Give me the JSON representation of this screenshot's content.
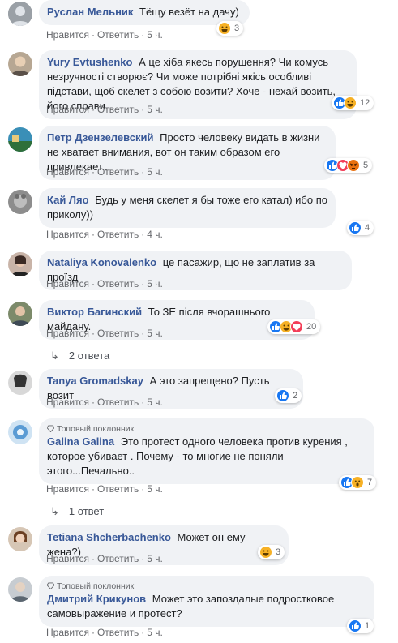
{
  "actions": {
    "like": "Нравится",
    "reply": "Ответить",
    "sep": "·"
  },
  "top_fan_label": "Топовый поклонник",
  "comments": [
    {
      "name": "Руслан Мельник",
      "text": "Тёщу везёт на дачу)",
      "time": "5 ч.",
      "reactions": [
        "haha"
      ],
      "count": "3"
    },
    {
      "name": "Yury Evtushenko",
      "text": "А це хіба якесь порушення? Чи комусь незручності створює? Чи може потрібні якісь особливі підстави, щоб скелет з собою возити? Хоче - нехай возить, його справи.",
      "time": "5 ч.",
      "reactions": [
        "like",
        "haha"
      ],
      "count": "12"
    },
    {
      "name": "Петр Дзензелевский",
      "text": "Просто человеку видать в жизни не хватает внимания, вот он таким образом его привлекает...",
      "time": "5 ч.",
      "reactions": [
        "like",
        "love",
        "angry"
      ],
      "count": "5"
    },
    {
      "name": "Кай Ляо",
      "text": "Будь у меня скелет я бы тоже его катал) ибо по приколу))",
      "time": "4 ч.",
      "reactions": [
        "like"
      ],
      "count": "4"
    },
    {
      "name": "Nataliya Konovalenko",
      "text": "це пасажир, що не заплатив за проїзд",
      "time": "5 ч.",
      "reactions": [],
      "count": ""
    },
    {
      "name": "Виктор Багинский",
      "text": "То ЗЕ після вчорашнього майдану.",
      "time": "5 ч.",
      "reactions": [
        "like",
        "haha",
        "love"
      ],
      "count": "20",
      "replies": "2 ответа"
    },
    {
      "name": "Tanya Gromadskay",
      "text": "А это запрещено? Пусть возит",
      "time": "5 ч.",
      "reactions": [
        "like"
      ],
      "count": "2"
    },
    {
      "name": "Galina Galina",
      "text": "Это протест одного человека против курения , которое убивает . Почему - то многие не поняли этого...Печально..",
      "time": "5 ч.",
      "reactions": [
        "like",
        "wow"
      ],
      "count": "7",
      "top_fan": true,
      "replies": "1 ответ"
    },
    {
      "name": "Tetiana Shcherbachenko",
      "text": "Может он ему жена?)",
      "time": "5 ч.",
      "reactions": [
        "haha"
      ],
      "count": "3"
    },
    {
      "name": "Дмитрий Крикунов",
      "text": "Может это запоздалые подростковое самовыражение и протест?",
      "time": "5 ч.",
      "reactions": [
        "like"
      ],
      "count": "1",
      "top_fan": true
    }
  ]
}
